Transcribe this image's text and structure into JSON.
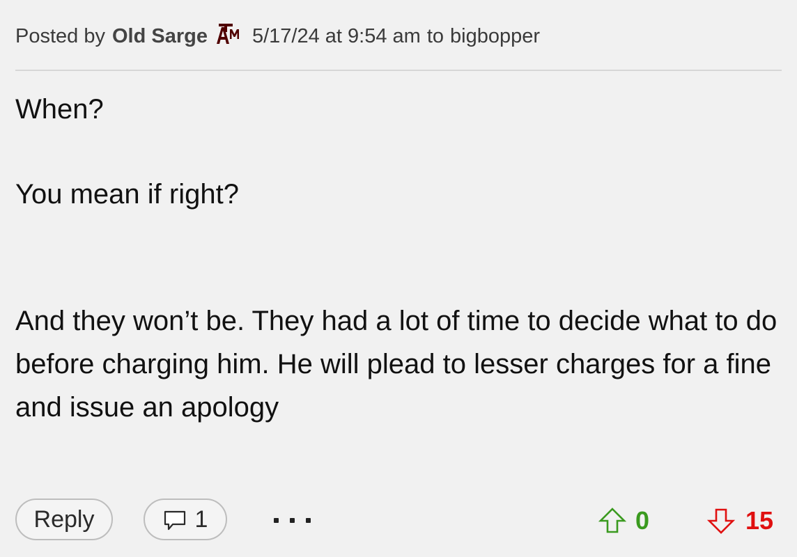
{
  "post": {
    "posted_by_label": "Posted by",
    "author": "Old Sarge",
    "team_logo_icon": "texas-am-logo-icon",
    "team_logo_text": "ATM",
    "timestamp": "5/17/24 at 9:54 am",
    "reply_to_label": "to",
    "reply_to_user": "bigbopper",
    "body": {
      "line1": "When?",
      "line2": "You mean if right?",
      "line3": "And they won’t be. They had a lot of time to decide what to do before charging him. He will plead to lesser charges for a fine and issue an apology"
    }
  },
  "actions": {
    "reply_label": "Reply",
    "comment_icon": "speech-bubble-icon",
    "comment_count": "1",
    "more_icon": "ellipsis-icon",
    "upvote_icon": "arrow-up-icon",
    "upvote_count": "0",
    "downvote_icon": "arrow-down-icon",
    "downvote_count": "15"
  },
  "colors": {
    "background": "#f1f1f1",
    "upvote": "#3a9a1f",
    "downvote": "#e01010",
    "logo_maroon": "#500000"
  }
}
